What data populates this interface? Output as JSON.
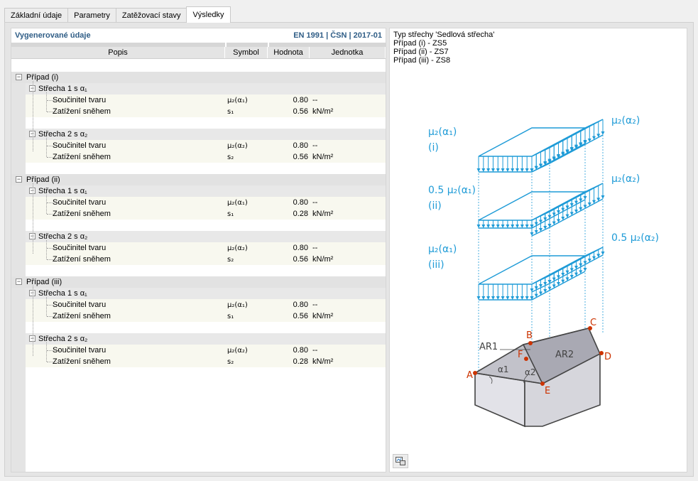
{
  "tabs": [
    "Základní údaje",
    "Parametry",
    "Zatěžovací stavy",
    "Výsledky"
  ],
  "active_tab": "Výsledky",
  "left": {
    "title": "Vygenerované údaje",
    "standard": "EN 1991 | ČSN | 2017-01",
    "columns": {
      "popis": "Popis",
      "symbol": "Symbol",
      "hodnota": "Hodnota",
      "jednotka": "Jednotka"
    },
    "cases": [
      {
        "label": "Případ (i)",
        "roofs": [
          {
            "label": "Střecha 1 s α₁",
            "rows": [
              {
                "name": "Součinitel tvaru",
                "symbol": "μ₂(α₁)",
                "value": "0.80",
                "unit": "--"
              },
              {
                "name": "Zatížení sněhem",
                "symbol": "s₁",
                "value": "0.56",
                "unit": "kN/m²"
              }
            ]
          },
          {
            "label": "Střecha 2 s α₂",
            "rows": [
              {
                "name": "Součinitel tvaru",
                "symbol": "μ₂(α₂)",
                "value": "0.80",
                "unit": "--"
              },
              {
                "name": "Zatížení sněhem",
                "symbol": "s₂",
                "value": "0.56",
                "unit": "kN/m²"
              }
            ]
          }
        ]
      },
      {
        "label": "Případ (ii)",
        "roofs": [
          {
            "label": "Střecha 1 s α₁",
            "rows": [
              {
                "name": "Součinitel tvaru",
                "symbol": "μ₂(α₁)",
                "value": "0.80",
                "unit": "--"
              },
              {
                "name": "Zatížení sněhem",
                "symbol": "s₁",
                "value": "0.28",
                "unit": "kN/m²"
              }
            ]
          },
          {
            "label": "Střecha 2 s α₂",
            "rows": [
              {
                "name": "Součinitel tvaru",
                "symbol": "μ₂(α₂)",
                "value": "0.80",
                "unit": "--"
              },
              {
                "name": "Zatížení sněhem",
                "symbol": "s₂",
                "value": "0.56",
                "unit": "kN/m²"
              }
            ]
          }
        ]
      },
      {
        "label": "Případ (iii)",
        "roofs": [
          {
            "label": "Střecha 1 s α₁",
            "rows": [
              {
                "name": "Součinitel tvaru",
                "symbol": "μ₂(α₁)",
                "value": "0.80",
                "unit": "--"
              },
              {
                "name": "Zatížení sněhem",
                "symbol": "s₁",
                "value": "0.56",
                "unit": "kN/m²"
              }
            ]
          },
          {
            "label": "Střecha 2 s α₂",
            "rows": [
              {
                "name": "Součinitel tvaru",
                "symbol": "μ₂(α₂)",
                "value": "0.80",
                "unit": "--"
              },
              {
                "name": "Zatížení sněhem",
                "symbol": "s₂",
                "value": "0.28",
                "unit": "kN/m²"
              }
            ]
          }
        ]
      }
    ]
  },
  "right": {
    "info": [
      "Typ střechy 'Sedlová střecha'",
      "Případ (i) - ZS5",
      "Případ (ii) - ZS7",
      "Případ (iii) - ZS8"
    ],
    "diagram": {
      "case_labels": [
        {
          "left": "μ₂(α₁)",
          "left2": "(i)",
          "right": "μ₂(α₂)"
        },
        {
          "left": "0.5 μ₂(α₁)",
          "left2": "(ii)",
          "right": "μ₂(α₂)"
        },
        {
          "left": "μ₂(α₁)",
          "left2": "(iii)",
          "right": "0.5 μ₂(α₂)"
        }
      ],
      "points": [
        "A",
        "B",
        "C",
        "D",
        "E",
        "F"
      ],
      "areas": [
        "AR1",
        "AR2"
      ],
      "angles": [
        "α1",
        "α2"
      ],
      "load_color": "#1e9bd7",
      "point_color": "#cc3300"
    },
    "icon_button": "export-picture-icon"
  }
}
